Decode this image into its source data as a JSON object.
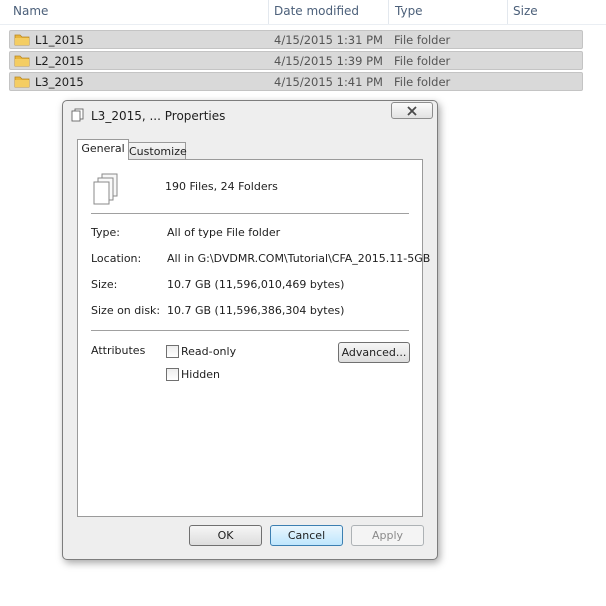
{
  "explorer": {
    "columns": {
      "name": "Name",
      "date": "Date modified",
      "type": "Type",
      "size": "Size"
    },
    "rows": [
      {
        "name": "L1_2015",
        "date": "4/15/2015 1:31 PM",
        "type": "File folder"
      },
      {
        "name": "L2_2015",
        "date": "4/15/2015 1:39 PM",
        "type": "File folder"
      },
      {
        "name": "L3_2015",
        "date": "4/15/2015 1:41 PM",
        "type": "File folder"
      }
    ]
  },
  "dialog": {
    "title": "L3_2015, ... Properties",
    "close_icon": "close-icon",
    "tabs": [
      "General",
      "Customize"
    ],
    "summary": "190 Files, 24 Folders",
    "type_label": "Type:",
    "type_value": "All of type File folder",
    "location_label": "Location:",
    "location_value": "All in G:\\DVDMR.COM\\Tutorial\\CFA_2015.11-5GB",
    "size_label": "Size:",
    "size_value": "10.7 GB (11,596,010,469 bytes)",
    "size_on_disk_label": "Size on disk:",
    "size_on_disk_value": "10.7 GB (11,596,386,304 bytes)",
    "attributes_label": "Attributes",
    "readonly_label": "Read-only",
    "hidden_label": "Hidden",
    "advanced_label": "Advanced...",
    "ok_label": "OK",
    "cancel_label": "Cancel",
    "apply_label": "Apply"
  },
  "colors": {
    "folder": "#e8b53c",
    "row_highlight": "#d9d9d9",
    "dialog_bg": "#eeeeee"
  }
}
